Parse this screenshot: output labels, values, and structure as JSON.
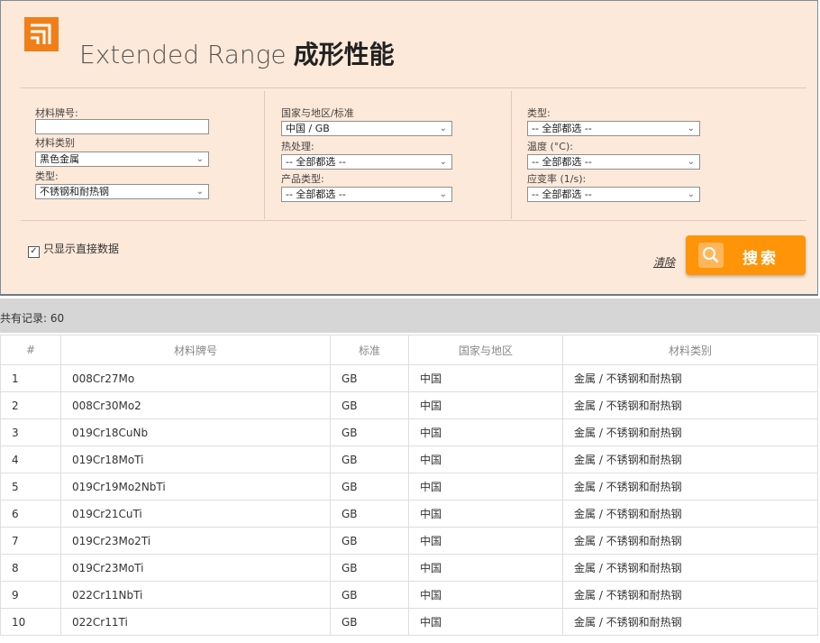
{
  "header": {
    "title_en": "Extended Range",
    "title_cn": "成形性能",
    "brand_color": "#f07f1a"
  },
  "filters": {
    "col1": {
      "material_no_label": "材料牌号:",
      "material_no_value": "",
      "material_category_label": "材料类别",
      "material_category_value": "黑色金属",
      "type_label": "类型:",
      "type_value": "不锈钢和耐热钢"
    },
    "col2": {
      "country_label": "国家与地区/标准",
      "country_value": "中国 / GB",
      "heat_label": "热处理:",
      "heat_value": "-- 全部都选 --",
      "product_label": "产品类型:",
      "product_value": "-- 全部都选 --"
    },
    "col3": {
      "type_label": "类型:",
      "type_value": "-- 全部都选 --",
      "temp_label": "温度 (°C):",
      "temp_value": "-- 全部都选 --",
      "strain_label": "应变率 (1/s):",
      "strain_value": "-- 全部都选 --"
    },
    "direct_only_label": "只显示直接数据",
    "direct_only_checked": true,
    "clear_label": "清除",
    "search_label": "搜索",
    "search_color": "#ff9408"
  },
  "results": {
    "count_label": "共有记录: 60",
    "columns": [
      "#",
      "材料牌号",
      "标准",
      "国家与地区",
      "材料类别"
    ],
    "rows": [
      {
        "n": "1",
        "grade": "008Cr27Mo",
        "std": "GB",
        "country": "中国",
        "cat": "金属 / 不锈钢和耐热钢"
      },
      {
        "n": "2",
        "grade": "008Cr30Mo2",
        "std": "GB",
        "country": "中国",
        "cat": "金属 / 不锈钢和耐热钢"
      },
      {
        "n": "3",
        "grade": "019Cr18CuNb",
        "std": "GB",
        "country": "中国",
        "cat": "金属 / 不锈钢和耐热钢"
      },
      {
        "n": "4",
        "grade": "019Cr18MoTi",
        "std": "GB",
        "country": "中国",
        "cat": "金属 / 不锈钢和耐热钢"
      },
      {
        "n": "5",
        "grade": "019Cr19Mo2NbTi",
        "std": "GB",
        "country": "中国",
        "cat": "金属 / 不锈钢和耐热钢"
      },
      {
        "n": "6",
        "grade": "019Cr21CuTi",
        "std": "GB",
        "country": "中国",
        "cat": "金属 / 不锈钢和耐热钢"
      },
      {
        "n": "7",
        "grade": "019Cr23Mo2Ti",
        "std": "GB",
        "country": "中国",
        "cat": "金属 / 不锈钢和耐热钢"
      },
      {
        "n": "8",
        "grade": "019Cr23MoTi",
        "std": "GB",
        "country": "中国",
        "cat": "金属 / 不锈钢和耐热钢"
      },
      {
        "n": "9",
        "grade": "022Cr11NbTi",
        "std": "GB",
        "country": "中国",
        "cat": "金属 / 不锈钢和耐热钢"
      },
      {
        "n": "10",
        "grade": "022Cr11Ti",
        "std": "GB",
        "country": "中国",
        "cat": "金属 / 不锈钢和耐热钢"
      }
    ]
  }
}
